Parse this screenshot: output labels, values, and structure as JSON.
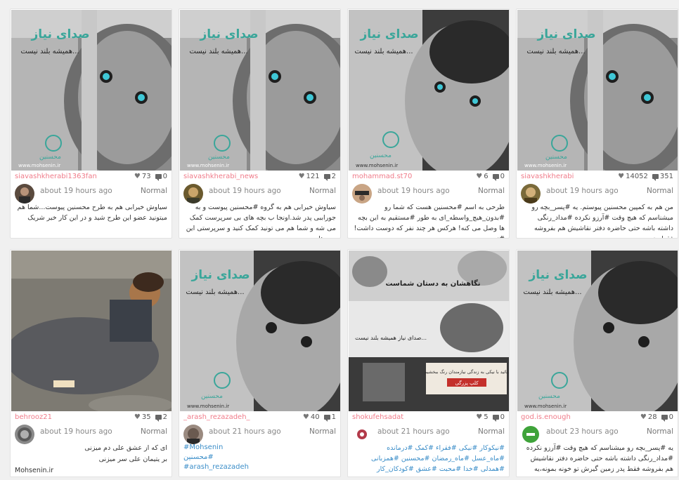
{
  "colors": {
    "username": "#f07c8a",
    "hashtag": "#3a8dc8",
    "teal": "#3aa69a"
  },
  "poster": {
    "line1": "صدای نیاز",
    "line2": "همیشه بلند نیست...",
    "brand": "محسنین",
    "url": "www.mohsenin.ir"
  },
  "collage": {
    "text1": "نگاهشان به دستان شماست",
    "text2": "صدای نیاز همیشه بلند نیست...",
    "text3": "بیائید با نیکی به زندگی نیازمندان رنگ ببخشیم",
    "text4": "کلپ پزرگی"
  },
  "cards": [
    {
      "username": "siavashkherabi1363fan",
      "likes": "73",
      "comments": "0",
      "time": "about 19 hours ago",
      "privacy": "Normal",
      "caption": "سیاوش خیرابی هم به طرح محسنین پیوست...شما هم میتونید عضو این طرح شید و در این کار خیر شریک"
    },
    {
      "username": "siavashkherabi_news",
      "likes": "121",
      "comments": "2",
      "time": "about 19 hours ago",
      "privacy": "Normal",
      "caption": "سیاوش خیرابی هم به گروه #محسنین پیوست و به جوراببی پدر شد.اونجا ب بچه های بی سرپرست کمک می شه و شما هم می تونید کمک کنید و سرپرستی این بچه ها"
    },
    {
      "username": "mohammad.st70",
      "likes": "6",
      "comments": "0",
      "time": "about 19 hours ago",
      "privacy": "Normal",
      "caption": "طرحی به اسم #محسنین هست که شما رو #بدون_هیچ_واسطه_ای به طور #مستقیم به این بچه ها وصل می کنه! هرکس هر چند نفر که دوست داشت! #نیت"
    },
    {
      "username": "siavashkherabi",
      "likes": "14052",
      "comments": "351",
      "time": "about 19 hours ago",
      "privacy": "Normal",
      "caption": "من هم به کمپین محسنین پیوستم. یه #پسر_بچه رو میشناسم که هیچ وقت #آرزو نکرده #مداد_رنگی داشته باشه حتی حاضره دفتر نقاشیش هم بفروشه فقط پدر زمین..."
    },
    {
      "username": "behrooz21",
      "likes": "35",
      "comments": "2",
      "time": "about 19 hours ago",
      "privacy": "Normal",
      "caption": "ای که از عشق علی دم میزنی",
      "caption2": "بر یتیمان علی سر میزنی",
      "caption3": "Mohsenin.ir"
    },
    {
      "username": "_arash_rezazadeh_",
      "likes": "40",
      "comments": "1",
      "time": "about 21 hours ago",
      "privacy": "Normal",
      "tags": [
        "#Mohsenin",
        "#محسنین",
        "#arash_rezazadeh"
      ]
    },
    {
      "username": "shokufehsadat",
      "likes": "5",
      "comments": "0",
      "time": "about 21 hours ago",
      "privacy": "Normal",
      "caption": "#نیکوکار #نیکی #فقراء #کمک #درمانده #ماه_عسل #ماه_رمضان #محسنین #همزبانی #همدلی #خدا #محبت #عشق #کودکان_کار #کودکی #یتیم #بینوا"
    },
    {
      "username": "god.is.enough",
      "likes": "28",
      "comments": "0",
      "time": "about 23 hours ago",
      "privacy": "Normal",
      "caption": "یه #پسر_بچه رو میشناسم که هیچ وقت #آرزو نکرده #مداد_رنگی داشته باشه حتی حاضره دفتر نقاشیش هم بفروشه فقط پدر زمین گیرش تو خونه بمونه،یه #دختر_بچه"
    }
  ]
}
